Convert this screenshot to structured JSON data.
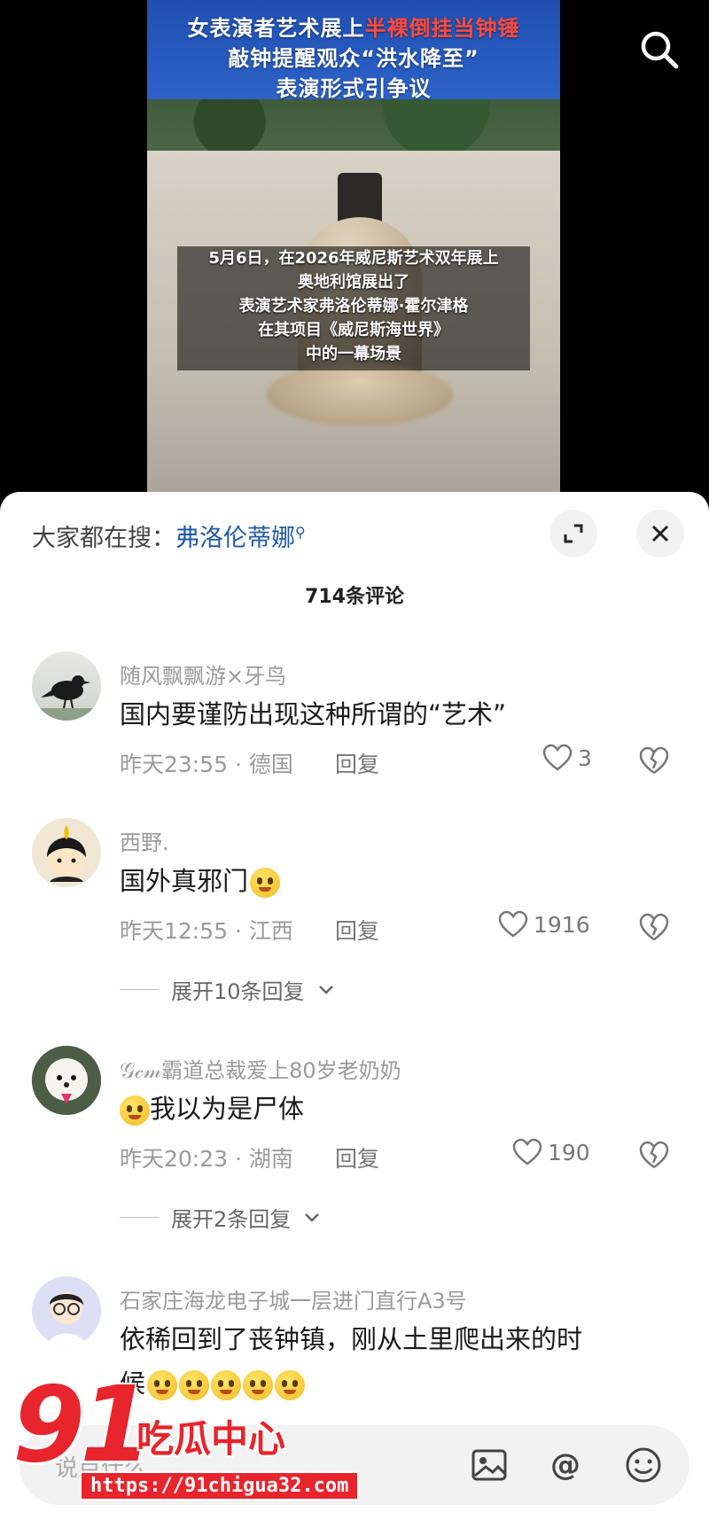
{
  "video": {
    "title_lines": [
      {
        "plain": "女表演者艺术展上",
        "highlight": "半裸倒挂当钟锤"
      },
      {
        "plain": "敲钟提醒观众“洪水降至”",
        "highlight": ""
      },
      {
        "plain": "表演形式引争议",
        "highlight": ""
      }
    ],
    "caption_lines": [
      "5月6日，在2026年威尼斯艺术双年展上",
      "奥地利馆展出了",
      "表演艺术家弗洛伦蒂娜·霍尔津格",
      "在其项目《威尼斯海世界》",
      "中的一幕场景"
    ],
    "search_icon": "search-icon"
  },
  "sheet": {
    "hot_search_label": "大家都在搜：",
    "hot_search_keyword": "弗洛伦蒂娜",
    "comment_count": "714条评论"
  },
  "comments": [
    {
      "username": "随风飘飘游×牙鸟",
      "text": "国内要谨防出现这种所谓的“艺术”",
      "meta": "昨天23:55 · 德国",
      "reply_label": "回复",
      "likes": "3"
    },
    {
      "username": "西野.",
      "text": "国外真邪门",
      "meta": "昨天12:55 · 江西",
      "reply_label": "回复",
      "likes": "1916",
      "expand": "展开10条回复"
    },
    {
      "username": "𝒢𝒸𝓂霸道总裁爱上80岁老奶奶",
      "text": "我以为是尸体",
      "meta": "昨天20:23 · 湖南",
      "reply_label": "回复",
      "likes": "190",
      "expand": "展开2条回复"
    },
    {
      "username": "石家庄海龙电子城一层进门直行A3号",
      "text": "依稀回到了丧钟镇，刚从土里爬出来的时",
      "text2": "候"
    }
  ],
  "input": {
    "placeholder": "说点什么"
  },
  "watermark": {
    "number": "91",
    "name": "吃瓜中心",
    "url": "https://91chigua32.com"
  },
  "colors": {
    "accent_link": "#1e5aa8",
    "watermark_red": "#e8242c",
    "title_highlight": "#ff4a3d",
    "title_banner": "#2d62c8"
  }
}
